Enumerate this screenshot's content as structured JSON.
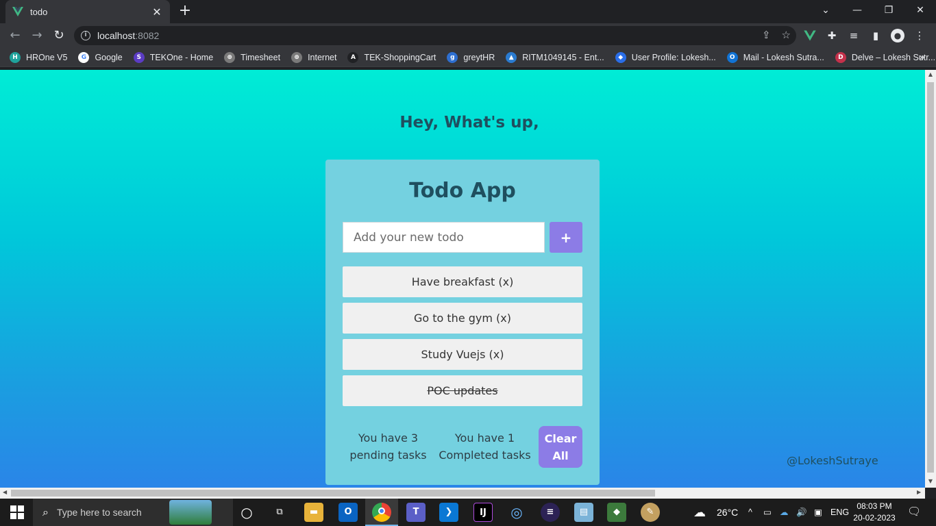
{
  "browser": {
    "tab_title": "todo",
    "tab_close": "✕",
    "new_tab": "+",
    "url_host": "localhost",
    "url_port": ":8082",
    "bookmarks": [
      {
        "label": "HROne V5",
        "color": "#1fa39c",
        "glyph": "H"
      },
      {
        "label": "Google",
        "color": "#ffffff",
        "glyph": "G"
      },
      {
        "label": "TEKOne - Home",
        "color": "#5b3cc4",
        "glyph": "S"
      },
      {
        "label": "Timesheet",
        "color": "#7a7a7a",
        "glyph": "⊕"
      },
      {
        "label": "Internet",
        "color": "#7a7a7a",
        "glyph": "⊕"
      },
      {
        "label": "TEK-ShoppingCart",
        "color": "#202124",
        "glyph": "A"
      },
      {
        "label": "greytHR",
        "color": "#2e6fd0",
        "glyph": "g"
      },
      {
        "label": "RITM1049145 - Ent...",
        "color": "#2a7bd0",
        "glyph": "▲"
      },
      {
        "label": "User Profile: Lokesh...",
        "color": "#2a6ee8",
        "glyph": "◆"
      },
      {
        "label": "Mail - Lokesh Sutra...",
        "color": "#1173d4",
        "glyph": "O"
      },
      {
        "label": "Delve – Lokesh Sutr...",
        "color": "#c4314b",
        "glyph": "D"
      }
    ],
    "bookmarks_more": "»"
  },
  "page": {
    "greeting": "Hey, What's up,",
    "title": "Todo App",
    "input_placeholder": "Add your new todo",
    "add_label": "+",
    "todos": [
      {
        "text": "Have breakfast (x)",
        "done": false
      },
      {
        "text": "Go to the gym (x)",
        "done": false
      },
      {
        "text": "Study Vuejs (x)",
        "done": false
      },
      {
        "text": "POC updates",
        "done": true
      }
    ],
    "pending_line1": "You have 3",
    "pending_line2": "pending tasks",
    "completed_line1": "You have 1",
    "completed_line2": "Completed tasks",
    "clear_line1": "Clear",
    "clear_line2": "All",
    "author": "@LokeshSutraye"
  },
  "taskbar": {
    "search_placeholder": "Type here to search",
    "temperature": "26°C",
    "language": "ENG",
    "time": "08:03 PM",
    "date": "20-02-2023"
  }
}
